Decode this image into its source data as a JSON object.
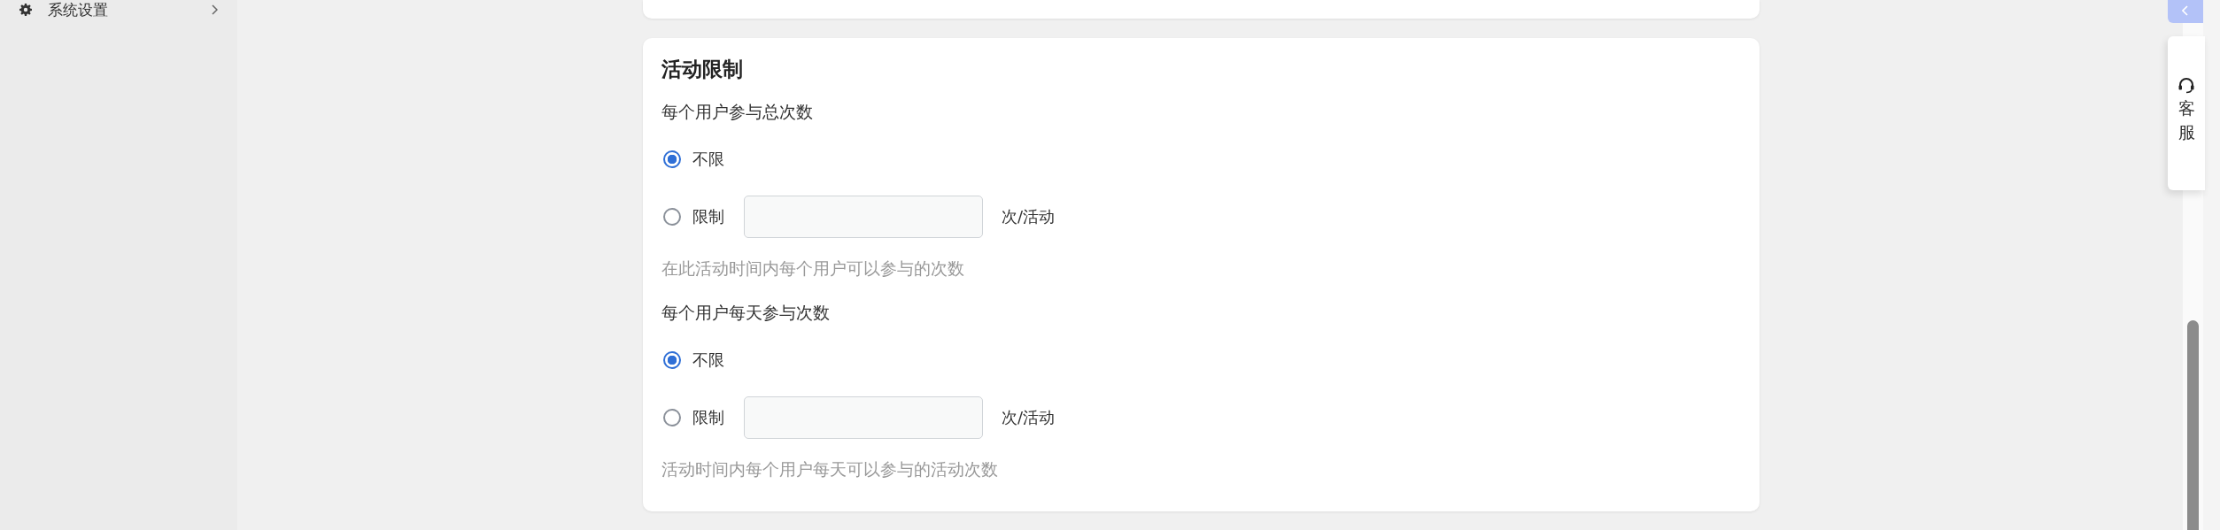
{
  "sidebar": {
    "items": [
      {
        "label": "系统设置"
      }
    ]
  },
  "card": {
    "title": "活动限制",
    "groups": [
      {
        "label": "每个用户参与总次数",
        "options": [
          {
            "label": "不限",
            "selected": true
          },
          {
            "label": "限制",
            "selected": false,
            "unit": "次/活动"
          }
        ],
        "hint": "在此活动时间内每个用户可以参与的次数"
      },
      {
        "label": "每个用户每天参与次数",
        "options": [
          {
            "label": "不限",
            "selected": true
          },
          {
            "label": "限制",
            "selected": false,
            "unit": "次/活动"
          }
        ],
        "hint": "活动时间内每个用户每天可以参与的活动次数"
      }
    ]
  },
  "side_widget": {
    "label": "客服"
  }
}
